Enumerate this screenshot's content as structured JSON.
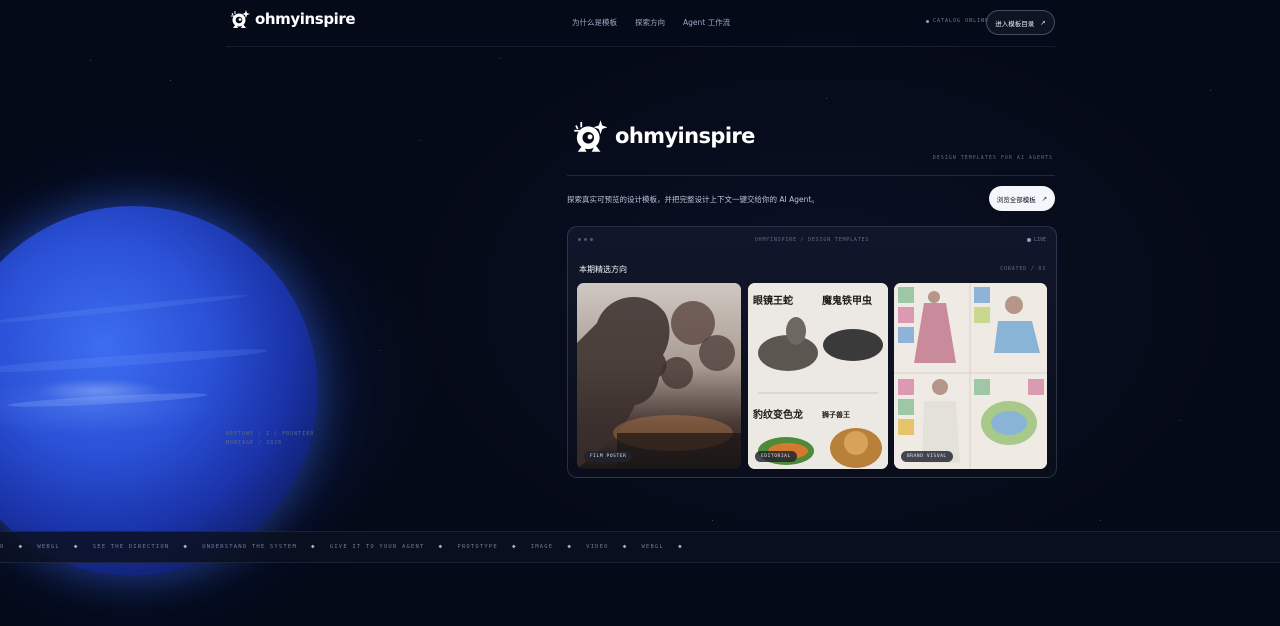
{
  "brand": {
    "name": "ohmyinspire"
  },
  "nav": {
    "links": [
      "为什么是模板",
      "探索方向",
      "Agent 工作流"
    ],
    "status": "CATALOG ONLINE",
    "cta_label": "进入模板目录",
    "cta_arrow": "↗"
  },
  "planet": {
    "line1": "NEPTUNE / I / FRONTIER",
    "line2": "MONTAGE / 2026"
  },
  "hero": {
    "tagline": "DESIGN TEMPLATES FOR AI AGENTS",
    "description": "探索真实可预览的设计模板，并把完整设计上下文一键交给你的 AI Agent。",
    "view_all_label": "浏览全部模板",
    "view_all_arrow": "↗"
  },
  "preview": {
    "path": "OHMYINSPIRE / DESIGN TEMPLATES",
    "live": "LIVE",
    "title": "本期精选方向",
    "count": "CURATED / 03",
    "cards": [
      {
        "chip": "FILM POSTER"
      },
      {
        "chip": "EDITORIAL",
        "texts": [
          "眼镜王蛇",
          "魔鬼铁甲虫",
          "豹纹变色龙",
          "狮子兽王"
        ]
      },
      {
        "chip": "BRAND VISUAL"
      }
    ]
  },
  "ticker": {
    "items": [
      "O",
      "WEBGL",
      "SEE THE DIRECTION",
      "UNDERSTAND THE SYSTEM",
      "GIVE IT TO YOUR AGENT",
      "PROTOTYPE",
      "IMAGE",
      "VIDEO",
      "WEBGL"
    ],
    "separator": "◆"
  }
}
